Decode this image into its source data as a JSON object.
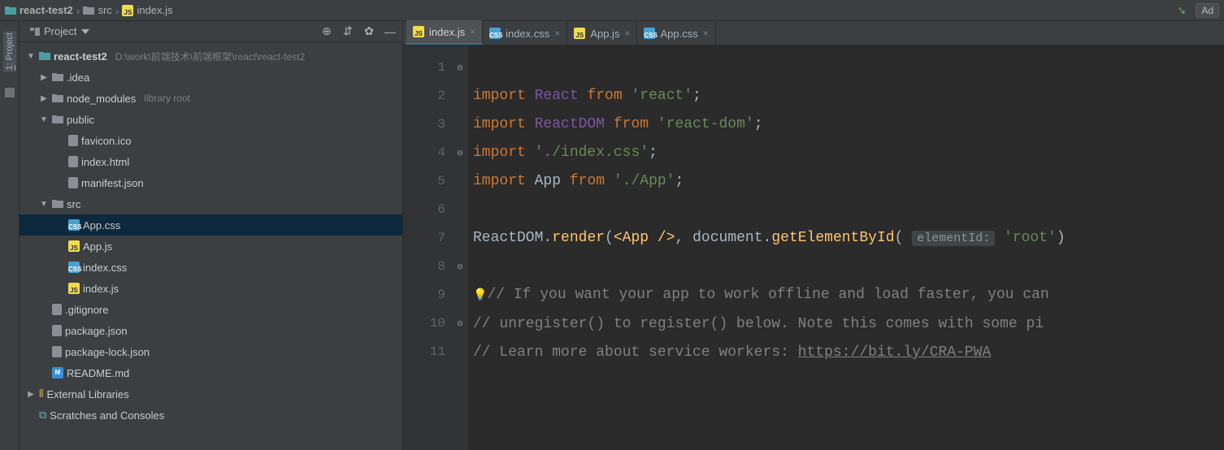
{
  "breadcrumb": {
    "items": [
      {
        "name": "react-test2",
        "icon": "folder-teal"
      },
      {
        "name": "src",
        "icon": "folder"
      },
      {
        "name": "index.js",
        "icon": "js"
      }
    ],
    "right_button": "Ad"
  },
  "tool_strip": {
    "project_label_num": "1",
    "project_label_text": ": Project"
  },
  "project_panel": {
    "title": "Project",
    "icons": {
      "locate": "⊕",
      "collapse": "⇵",
      "settings": "✿",
      "hide": "—"
    },
    "root": {
      "name": "react-test2",
      "path": "D:\\work\\前端技术\\前端框架\\react\\react-test2"
    },
    "tree": [
      {
        "depth": 1,
        "expand": "closed",
        "icon": "folder",
        "name": ".idea"
      },
      {
        "depth": 1,
        "expand": "closed",
        "icon": "folder",
        "name": "node_modules",
        "extra": "library root"
      },
      {
        "depth": 1,
        "expand": "open",
        "icon": "folder",
        "name": "public"
      },
      {
        "depth": 2,
        "expand": "",
        "icon": "file",
        "name": "favicon.ico"
      },
      {
        "depth": 2,
        "expand": "",
        "icon": "file",
        "name": "index.html"
      },
      {
        "depth": 2,
        "expand": "",
        "icon": "file",
        "name": "manifest.json"
      },
      {
        "depth": 1,
        "expand": "open",
        "icon": "folder",
        "name": "src"
      },
      {
        "depth": 2,
        "expand": "",
        "icon": "css",
        "name": "App.css",
        "selected": true
      },
      {
        "depth": 2,
        "expand": "",
        "icon": "js",
        "name": "App.js"
      },
      {
        "depth": 2,
        "expand": "",
        "icon": "css",
        "name": "index.css"
      },
      {
        "depth": 2,
        "expand": "",
        "icon": "js",
        "name": "index.js"
      },
      {
        "depth": 1,
        "expand": "",
        "icon": "file",
        "name": ".gitignore"
      },
      {
        "depth": 1,
        "expand": "",
        "icon": "file",
        "name": "package.json"
      },
      {
        "depth": 1,
        "expand": "",
        "icon": "file",
        "name": "package-lock.json"
      },
      {
        "depth": 1,
        "expand": "",
        "icon": "md",
        "name": "README.md"
      }
    ],
    "external_libs": "External Libraries",
    "scratches": "Scratches and Consoles"
  },
  "editor": {
    "tabs": [
      {
        "icon": "js",
        "label": "index.js",
        "active": true
      },
      {
        "icon": "css",
        "label": "index.css",
        "active": false
      },
      {
        "icon": "js",
        "label": "App.js",
        "active": false
      },
      {
        "icon": "css",
        "label": "App.css",
        "active": false
      }
    ],
    "line_numbers": [
      "1",
      "2",
      "3",
      "4",
      "5",
      "6",
      "7",
      "8",
      "9",
      "10",
      "11"
    ],
    "code": {
      "l1_kw": "import",
      "l1_name": "React",
      "l1_from": "from",
      "l1_str": "'react'",
      "l2_kw": "import",
      "l2_name": "ReactDOM",
      "l2_from": "from",
      "l2_str": "'react-dom'",
      "l3_kw": "import",
      "l3_str": "'./index.css'",
      "l4_kw": "import",
      "l4_name": "App",
      "l4_from": "from",
      "l4_str": "'./App'",
      "l6_obj": "ReactDOM",
      "l6_fn": "render",
      "l6_jsx1": "<",
      "l6_jsx2": "App ",
      "l6_jsx3": "/>",
      "l6_doc": "document",
      "l6_fn2": "getElementById",
      "l6_hint": "elementId:",
      "l6_root": "'root'",
      "l8": "// If you want your app to work offline and load faster, you can ",
      "l9": "// unregister() to register() below. Note this comes with some pi",
      "l10a": "// Learn more about service workers: ",
      "l10b": "https://bit.ly/CRA-PWA"
    }
  }
}
